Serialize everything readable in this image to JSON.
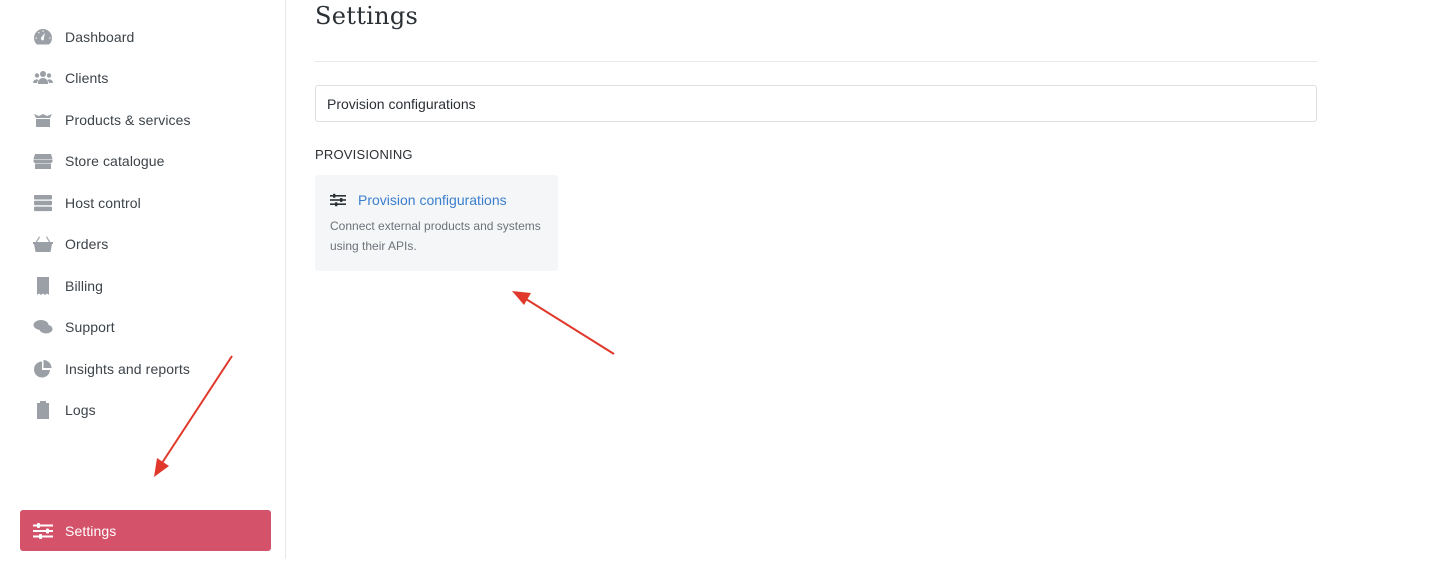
{
  "sidebar": {
    "items": [
      {
        "label": "Dashboard",
        "icon": "dashboard-gauge-icon"
      },
      {
        "label": "Clients",
        "icon": "users-icon"
      },
      {
        "label": "Products & services",
        "icon": "boxes-icon"
      },
      {
        "label": "Store catalogue",
        "icon": "store-icon"
      },
      {
        "label": "Host control",
        "icon": "server-icon"
      },
      {
        "label": "Orders",
        "icon": "basket-icon"
      },
      {
        "label": "Billing",
        "icon": "receipt-icon"
      },
      {
        "label": "Support",
        "icon": "chat-bubbles-icon"
      },
      {
        "label": "Insights and reports",
        "icon": "pie-chart-icon"
      },
      {
        "label": "Logs",
        "icon": "clipboard-icon"
      }
    ],
    "settings": {
      "label": "Settings",
      "icon": "sliders-icon",
      "active": true
    }
  },
  "main": {
    "title": "Settings",
    "search": {
      "value": "Provision configurations"
    },
    "section": {
      "heading": "PROVISIONING",
      "card": {
        "title": "Provision configurations",
        "description": "Connect external products and systems using their APIs.",
        "icon": "sliders-icon"
      }
    }
  },
  "colors": {
    "accent": "#d4526a",
    "link": "#3a7fcf",
    "annotation_arrow": "#e0392b"
  }
}
